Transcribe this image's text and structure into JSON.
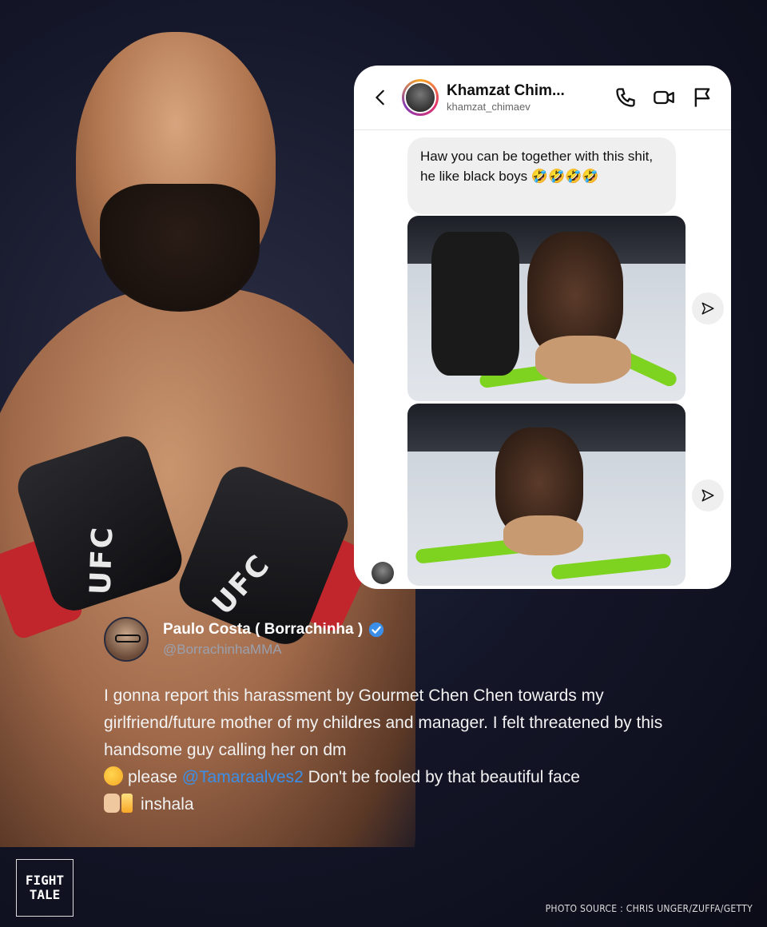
{
  "dm": {
    "contact_name": "Khamzat Chim...",
    "contact_handle": "khamzat_chimaev",
    "message_text": "Haw you can be together with this shit,  he like black boys",
    "message_emojis": "🤣🤣🤣🤣"
  },
  "tweet": {
    "author_name": "Paulo Costa ( Borrachinha )",
    "author_handle": "@BorrachinhaMMA",
    "text_part1": "I gonna report this harassment by Gourmet Chen Chen towards my girlfriend/future mother of my childres and manager. I felt threatened by this handsome guy calling her on dm",
    "text_part2": "please",
    "mention": "@Tamaraalves2",
    "text_part3": "Don't be fooled by that beautiful face",
    "text_part4": "inshala"
  },
  "branding": {
    "logo_line1": "FIGHT",
    "logo_line2": "TALE",
    "photo_source": "PHOTO SOURCE : CHRIS UNGER/ZUFFA/GETTY"
  },
  "photo": {
    "glove_text": "UFC"
  },
  "colors": {
    "mention": "#3b8fe8",
    "verified": "#3b8fe8",
    "background": "#15172a"
  },
  "icons": [
    "back-icon",
    "phone-icon",
    "video-call-icon",
    "flag-icon",
    "share-icon",
    "verified-icon"
  ]
}
